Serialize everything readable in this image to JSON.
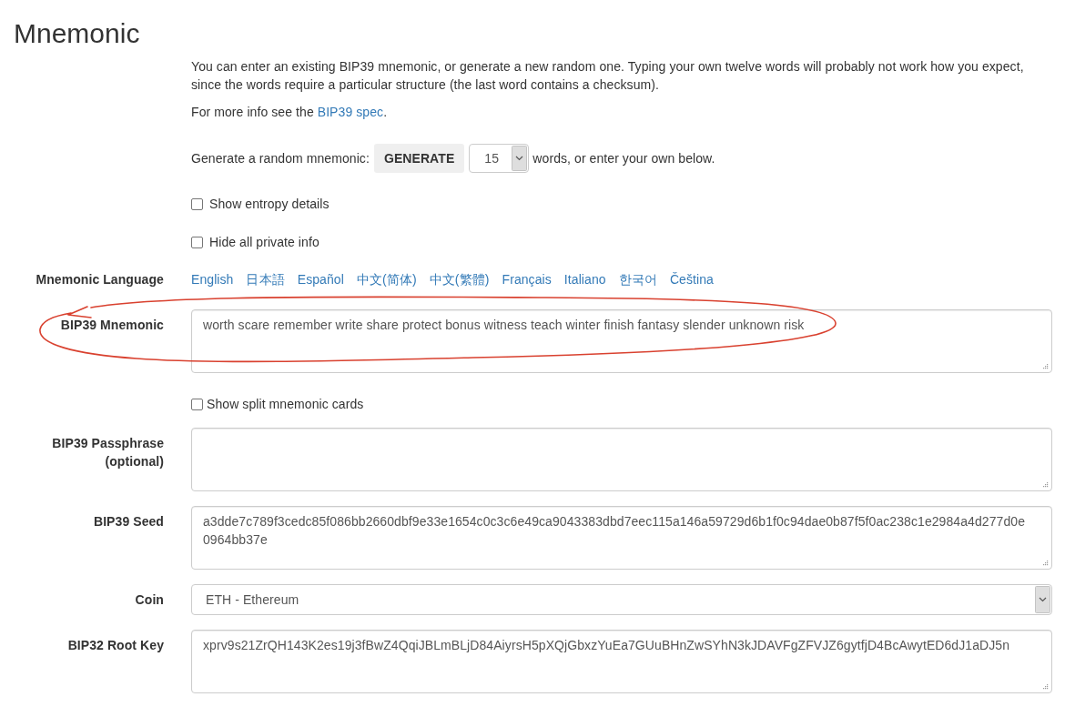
{
  "heading": "Mnemonic",
  "intro": "You can enter an existing BIP39 mnemonic, or generate a new random one. Typing your own twelve words will probably not work how you expect, since the words require a particular structure (the last word contains a checksum).",
  "more_info": {
    "before": "For more info see the",
    "link": "BIP39 spec",
    "after": "."
  },
  "generate": {
    "label": "Generate a random mnemonic:",
    "button": "GENERATE",
    "word_count": "15",
    "suffix": "words, or enter your own below."
  },
  "options": [
    {
      "label": "Show entropy details",
      "checked": false
    },
    {
      "label": "Hide all private info",
      "checked": false
    }
  ],
  "form_rows": [
    {
      "kind": "links",
      "label": "Mnemonic Language",
      "links": [
        "English",
        "日本語",
        "Español",
        "中文(简体)",
        "中文(繁體)",
        "Français",
        "Italiano",
        "한국어",
        "Čeština"
      ],
      "circled": false
    },
    {
      "kind": "textarea",
      "label": "BIP39 Mnemonic",
      "value": "worth scare remember write share protect bonus witness teach winter finish fantasy slender unknown risk",
      "circled": true
    },
    {
      "kind": "checkbox",
      "label": "Show split mnemonic cards",
      "checked": false,
      "circled": false
    },
    {
      "kind": "textarea",
      "label": "BIP39 Passphrase (optional)",
      "circled": false
    },
    {
      "kind": "textarea",
      "label": "BIP39 Seed",
      "value": "a3dde7c789f3cedc85f086bb2660dbf9e33e1654c0c3c6e49ca9043383dbd7eec115a146a59729d6b1f0c94dae0b87f5f0ac238c1e2984a4d277d0e0964bb37e",
      "circled": false
    },
    {
      "kind": "select",
      "label": "Coin",
      "value": "ETH - Ethereum",
      "circled": false
    },
    {
      "kind": "textarea",
      "label": "BIP32 Root Key",
      "value": "xprv9s21ZrQH143K2es19j3fBwZ4QqiJBLmBLjD84AiyrsH5pXQjGbxzYuEa7GUuBHnZwSYhN3kJDAVFgZFVJZ6gytfjD4BcAwytED6dJ1aDJ5n",
      "circled": false
    }
  ]
}
